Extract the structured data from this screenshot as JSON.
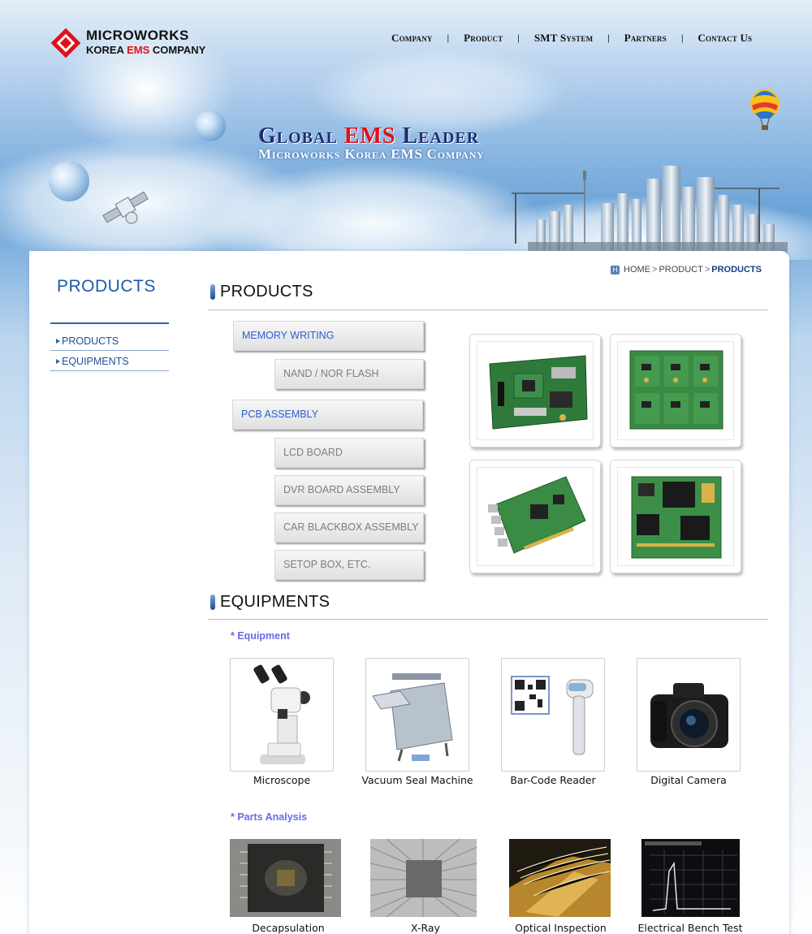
{
  "brand": {
    "line1": "MICROWORKS",
    "line2_pre": "KOREA ",
    "line2_red": "EMS",
    "line2_post": " COMPANY"
  },
  "nav": {
    "items": [
      "Company",
      "Product",
      "SMT System",
      "Partners",
      "Contact Us"
    ],
    "separator": "|"
  },
  "hero": {
    "line1_pre": "Global ",
    "line1_red": "EMS",
    "line1_post": " Leader",
    "line2": "Microworks Korea EMS Company"
  },
  "sidebar": {
    "title": "PRODUCTS",
    "items": [
      "PRODUCTS",
      "EQUIPMENTS"
    ]
  },
  "breadcrumb": {
    "home": "HOME",
    "section": "PRODUCT",
    "current": "PRODUCTS",
    "sep": ">"
  },
  "products": {
    "title": "PRODUCTS",
    "menu": [
      {
        "label": "MEMORY  WRITING",
        "level": "main"
      },
      {
        "label": "NAND / NOR FLASH",
        "level": "sub"
      },
      {
        "label": "PCB   ASSEMBLY",
        "level": "main"
      },
      {
        "label": "LCD BOARD",
        "level": "sub"
      },
      {
        "label": "DVR  BOARD ASSEMBLY",
        "level": "sub"
      },
      {
        "label": "CAR BLACKBOX ASSEMBLY",
        "level": "sub"
      },
      {
        "label": "SETOP BOX, ETC.",
        "level": "sub"
      }
    ]
  },
  "equipments": {
    "title": "EQUIPMENTS",
    "equipment_heading": "* Equipment",
    "equipment_items": [
      "Microscope",
      "Vacuum Seal Machine",
      "Bar-Code Reader",
      "Digital Camera"
    ],
    "analysis_heading": "* Parts Analysis",
    "analysis_items": [
      "Decapsulation",
      "X-Ray",
      "Optical Inspection",
      "Electrical Bench Test"
    ]
  },
  "colors": {
    "accent_blue": "#1c5aa8",
    "brand_red": "#e0101a",
    "menu_main_text": "#2c5ed0",
    "sub_heading": "#6a6ae6"
  }
}
